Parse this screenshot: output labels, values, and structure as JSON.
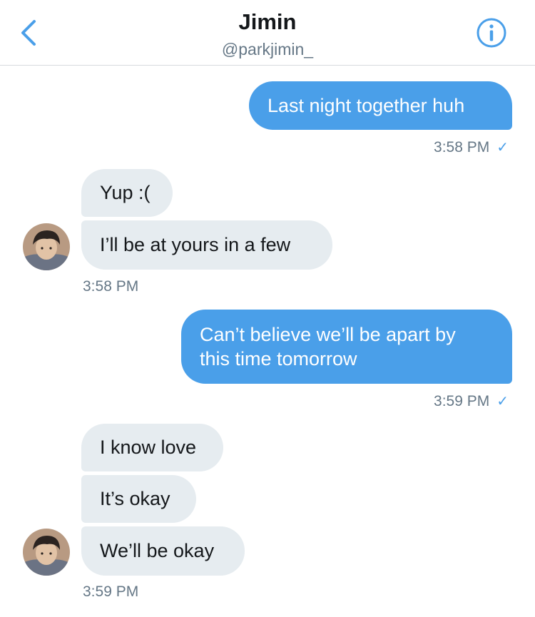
{
  "header": {
    "title": "Jimin",
    "handle": "@parkjimin_",
    "back_icon": "chevron-left-icon",
    "info_icon": "info-icon",
    "accent": "#4a9fe9"
  },
  "messages": [
    {
      "direction": "outgoing",
      "text": "Last night together huh"
    },
    {
      "direction": "outgoing-timestamp",
      "time": "3:58 PM",
      "status": "✓"
    },
    {
      "direction": "incoming",
      "text": "Yup :("
    },
    {
      "direction": "incoming",
      "text": "I’ll be at yours in a few"
    },
    {
      "direction": "incoming-timestamp",
      "time": "3:58 PM"
    },
    {
      "direction": "outgoing",
      "text_line1": "Can’t believe we’ll be apart by",
      "text_line2": "this time tomorrow"
    },
    {
      "direction": "outgoing-timestamp",
      "time": "3:59 PM",
      "status": "✓"
    },
    {
      "direction": "incoming",
      "text": "I know love"
    },
    {
      "direction": "incoming",
      "text": "It’s okay"
    },
    {
      "direction": "incoming",
      "text": "We’ll be okay"
    },
    {
      "direction": "incoming-timestamp",
      "time": "3:59 PM"
    }
  ],
  "colors": {
    "outgoing_bubble": "#4a9fe9",
    "incoming_bubble": "#e6ecf0",
    "timestamp": "#657786"
  }
}
